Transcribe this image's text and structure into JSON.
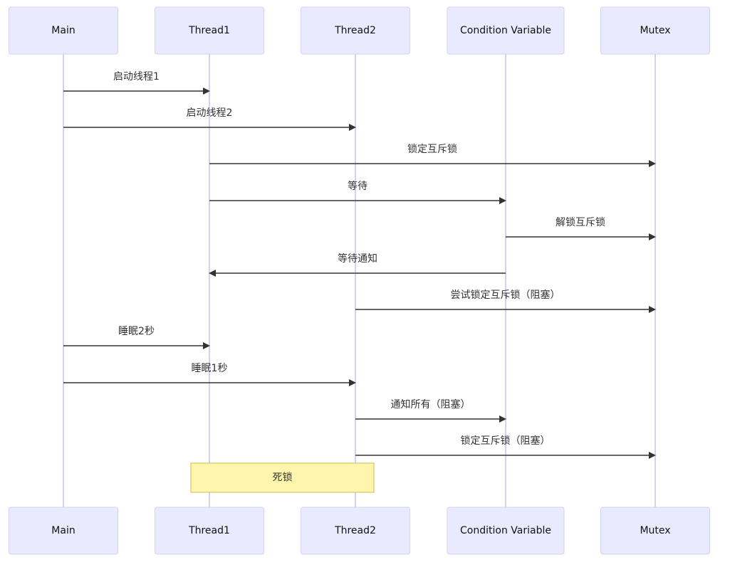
{
  "diagram": {
    "type": "sequence",
    "actors": [
      {
        "id": "main",
        "label": "Main"
      },
      {
        "id": "t1",
        "label": "Thread1"
      },
      {
        "id": "t2",
        "label": "Thread2"
      },
      {
        "id": "cv",
        "label": "Condition Variable"
      },
      {
        "id": "mutex",
        "label": "Mutex"
      }
    ],
    "messages": [
      {
        "from": "main",
        "to": "t1",
        "label": "启动线程1"
      },
      {
        "from": "main",
        "to": "t2",
        "label": "启动线程2"
      },
      {
        "from": "t1",
        "to": "mutex",
        "label": "锁定互斥锁"
      },
      {
        "from": "t1",
        "to": "cv",
        "label": "等待"
      },
      {
        "from": "cv",
        "to": "mutex",
        "label": "解锁互斥锁"
      },
      {
        "from": "cv",
        "to": "t1",
        "label": "等待通知"
      },
      {
        "from": "t2",
        "to": "mutex",
        "label": "尝试锁定互斥锁（阻塞）"
      },
      {
        "from": "main",
        "to": "t1",
        "label": "睡眠2秒"
      },
      {
        "from": "main",
        "to": "t2",
        "label": "睡眠1秒"
      },
      {
        "from": "t2",
        "to": "cv",
        "label": "通知所有（阻塞）"
      },
      {
        "from": "t2",
        "to": "mutex",
        "label": "锁定互斥锁（阻塞）"
      }
    ],
    "notes": [
      {
        "over": [
          "t1",
          "t2"
        ],
        "label": "死锁"
      }
    ],
    "colors": {
      "actor_fill": "#eaeaff",
      "actor_border": "#d5d0f5",
      "lifeline": "#d5d0f5",
      "message_line": "#333333",
      "note_fill": "#fff5ad",
      "note_border": "#c4c04a"
    }
  }
}
